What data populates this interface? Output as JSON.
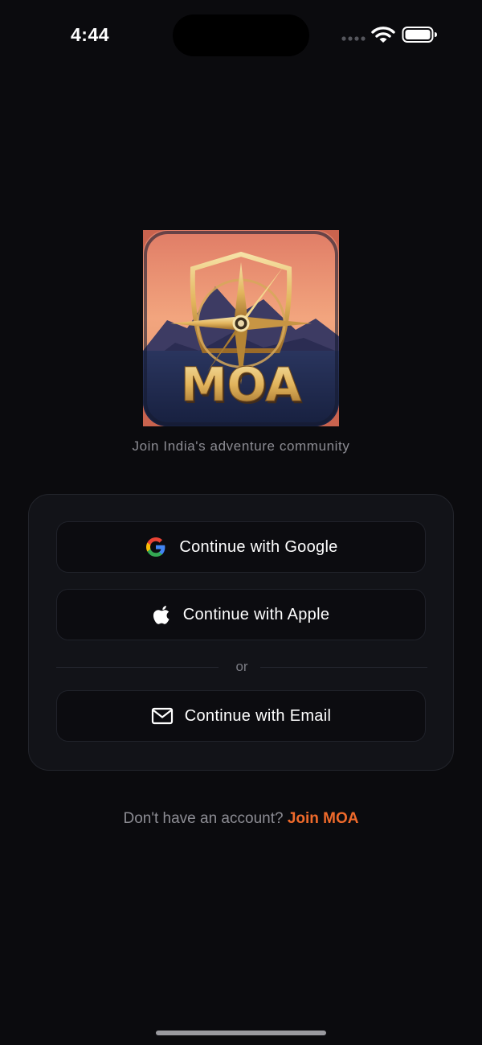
{
  "status_bar": {
    "time": "4:44"
  },
  "logo": {
    "text": "MOA"
  },
  "tagline": "Join India's adventure community",
  "auth": {
    "google_label": "Continue with Google",
    "apple_label": "Continue with Apple",
    "divider_text": "or",
    "email_label": "Continue with Email"
  },
  "signup": {
    "prompt": "Don't have an account?",
    "link_label": "Join MOA"
  },
  "colors": {
    "background": "#0b0b0e",
    "accent": "#ef6a2b",
    "card": "#121318"
  },
  "icons": [
    "signal-icon",
    "wifi-icon",
    "battery-icon",
    "google-icon",
    "apple-icon",
    "mail-icon"
  ]
}
